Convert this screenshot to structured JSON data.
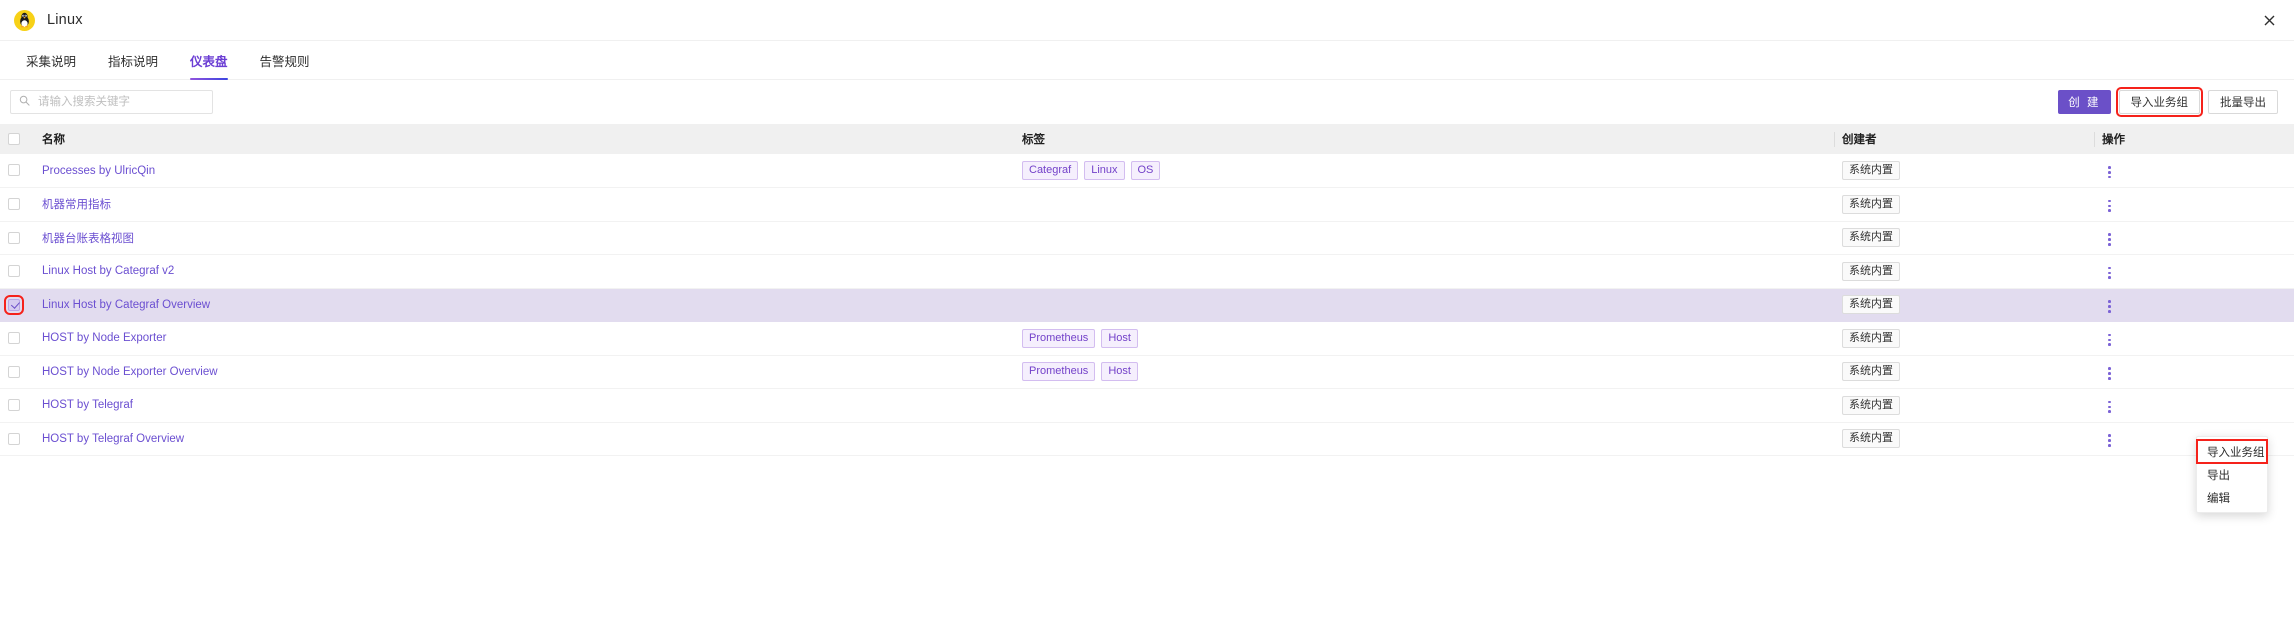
{
  "window": {
    "title": "Linux",
    "logo_icon": "linux-penguin-icon",
    "close_icon": "close-icon"
  },
  "tabs": [
    {
      "label": "采集说明",
      "active": false
    },
    {
      "label": "指标说明",
      "active": false
    },
    {
      "label": "仪表盘",
      "active": true
    },
    {
      "label": "告警规则",
      "active": false
    }
  ],
  "toolbar": {
    "search": {
      "icon": "search-icon",
      "placeholder": "请输入搜索关键字",
      "value": ""
    },
    "buttons": [
      {
        "label": "创 建",
        "style": "primary",
        "highlighted": false
      },
      {
        "label": "导入业务组",
        "style": "default",
        "highlighted": true
      },
      {
        "label": "批量导出",
        "style": "default",
        "highlighted": false
      }
    ]
  },
  "table": {
    "columns": [
      "名称",
      "标签",
      "创建者",
      "操作"
    ],
    "rows": [
      {
        "name": "Processes by UlricQin",
        "tags": [
          "Categraf",
          "Linux",
          "OS"
        ],
        "owner": "系统内置",
        "checked": false,
        "selected": false
      },
      {
        "name": "机器常用指标",
        "tags": [],
        "owner": "系统内置",
        "checked": false,
        "selected": false
      },
      {
        "name": "机器台账表格视图",
        "tags": [],
        "owner": "系统内置",
        "checked": false,
        "selected": false
      },
      {
        "name": "Linux Host by Categraf v2",
        "tags": [],
        "owner": "系统内置",
        "checked": false,
        "selected": false
      },
      {
        "name": "Linux Host by Categraf Overview",
        "tags": [],
        "owner": "系统内置",
        "checked": true,
        "selected": true
      },
      {
        "name": "HOST by Node Exporter",
        "tags": [
          "Prometheus",
          "Host"
        ],
        "owner": "系统内置",
        "checked": false,
        "selected": false
      },
      {
        "name": "HOST by Node Exporter Overview",
        "tags": [
          "Prometheus",
          "Host"
        ],
        "owner": "系统内置",
        "checked": false,
        "selected": false
      },
      {
        "name": "HOST by Telegraf",
        "tags": [],
        "owner": "系统内置",
        "checked": false,
        "selected": false
      },
      {
        "name": "HOST by Telegraf Overview",
        "tags": [],
        "owner": "系统内置",
        "checked": false,
        "selected": false
      }
    ]
  },
  "context_menu": {
    "items": [
      {
        "label": "导入业务组",
        "highlighted": true
      },
      {
        "label": "导出",
        "highlighted": false
      },
      {
        "label": "编辑",
        "highlighted": false
      }
    ]
  },
  "colors": {
    "accent": "#6b50c8",
    "link": "#6b4fd1",
    "highlight_outline": "#f5221b",
    "selected_row": "#e2dcef",
    "logo_bg": "#f7d117"
  }
}
